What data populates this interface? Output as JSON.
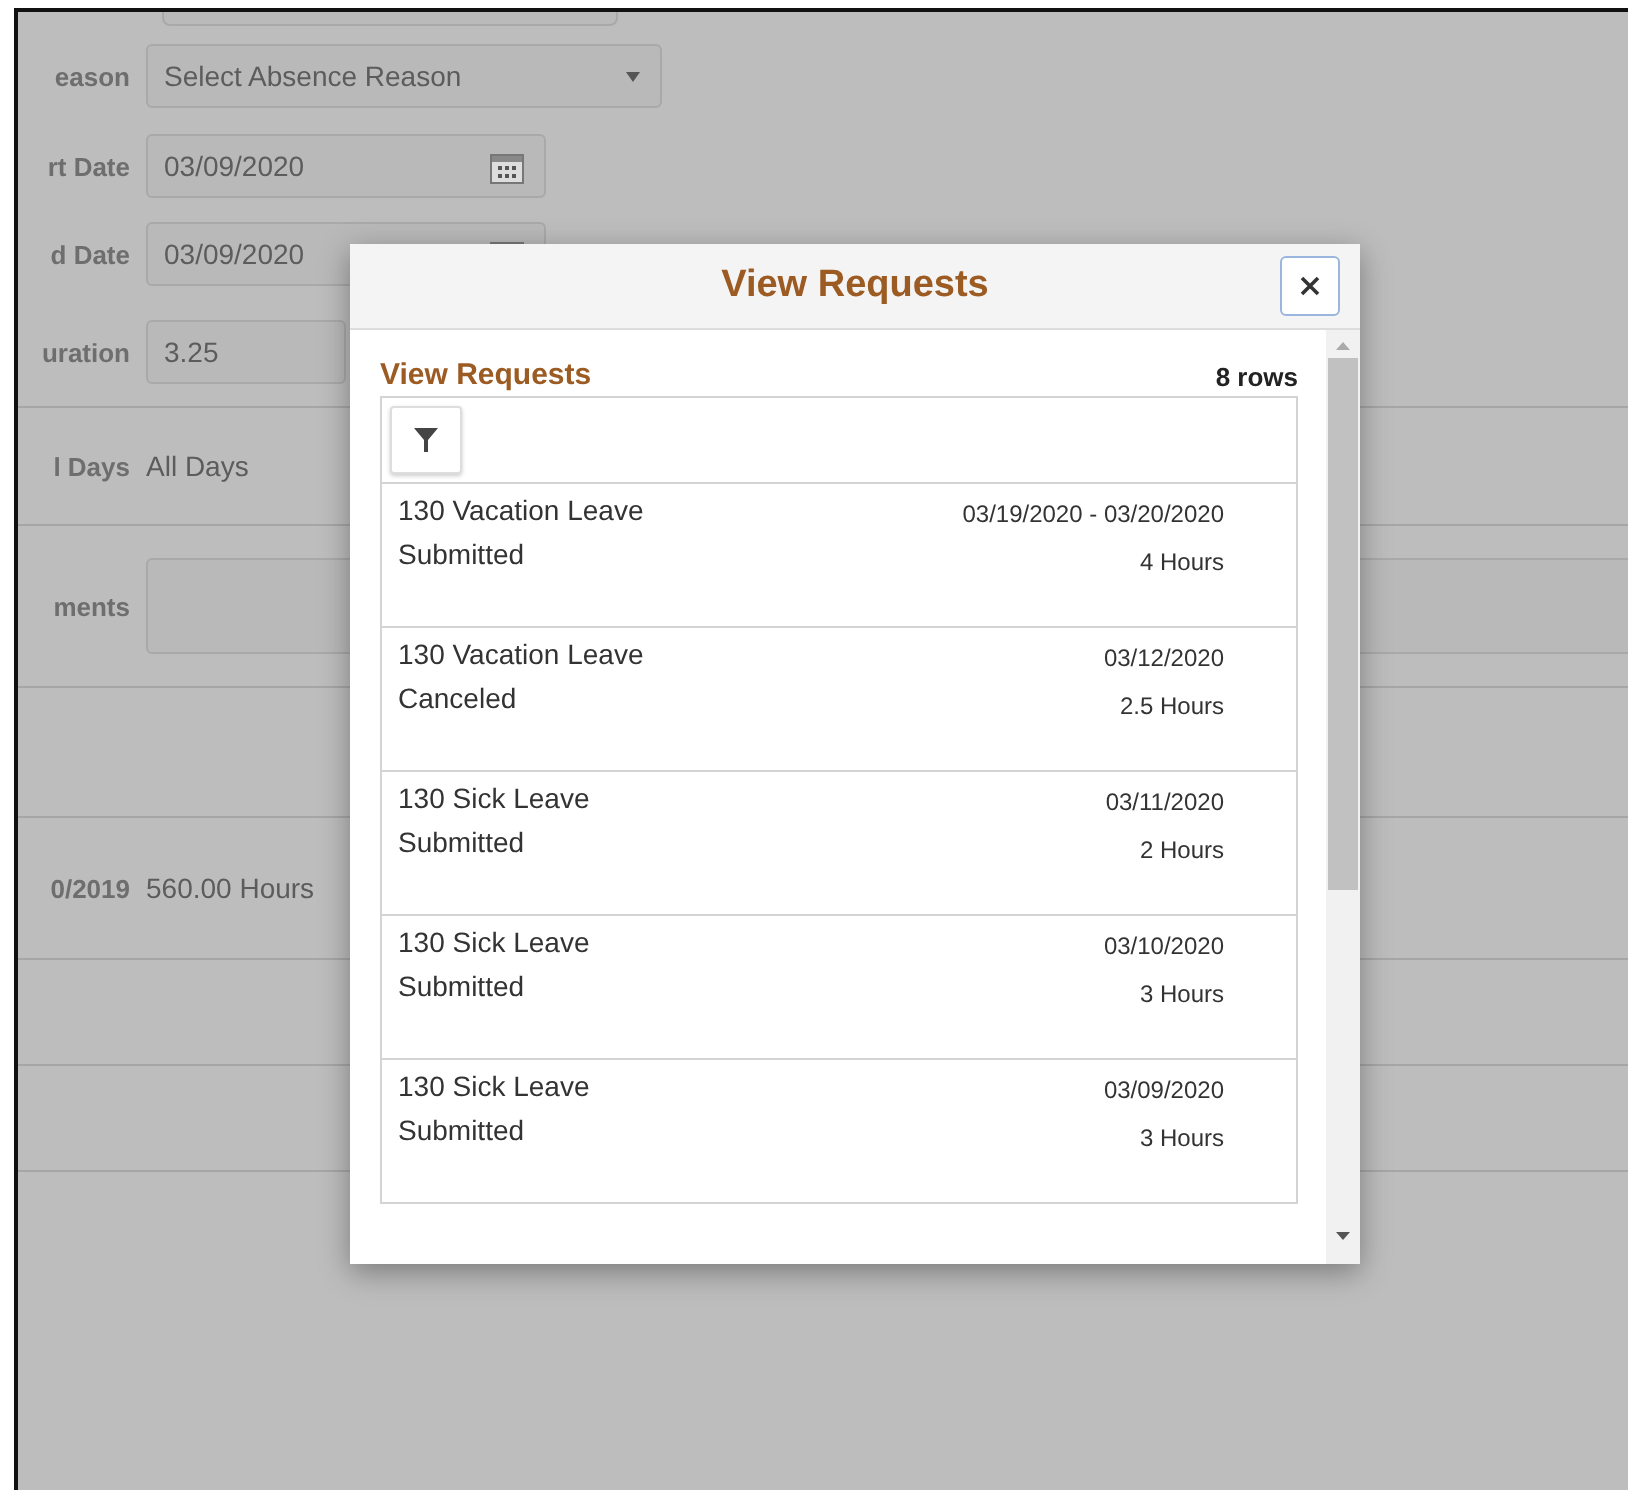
{
  "form": {
    "rows": [
      {
        "kind": "select",
        "label": "eason",
        "value": "Select Absence Reason"
      },
      {
        "kind": "date",
        "label": "rt Date",
        "value": "03/09/2020"
      },
      {
        "kind": "date",
        "label": "d Date",
        "value": "03/09/2020"
      },
      {
        "kind": "input",
        "label": "uration",
        "value": "3.25"
      },
      {
        "kind": "text",
        "label": "l Days",
        "value": "All Days"
      },
      {
        "kind": "textarea",
        "label": "ments",
        "value": ""
      },
      {
        "kind": "blank"
      },
      {
        "kind": "text",
        "label": "0/2019",
        "value": "560.00 Hours"
      },
      {
        "kind": "blank"
      },
      {
        "kind": "blank"
      }
    ]
  },
  "modal": {
    "title": "View Requests",
    "section_title": "View Requests",
    "row_count": "8 rows",
    "requests": [
      {
        "type": "130 Vacation Leave",
        "status": "Submitted",
        "dates": "03/19/2020 - 03/20/2020",
        "duration": "4 Hours"
      },
      {
        "type": "130 Vacation Leave",
        "status": "Canceled",
        "dates": "03/12/2020",
        "duration": "2.5 Hours"
      },
      {
        "type": "130 Sick Leave",
        "status": "Submitted",
        "dates": "03/11/2020",
        "duration": "2 Hours"
      },
      {
        "type": "130 Sick Leave",
        "status": "Submitted",
        "dates": "03/10/2020",
        "duration": "3 Hours"
      },
      {
        "type": "130 Sick Leave",
        "status": "Submitted",
        "dates": "03/09/2020",
        "duration": "3 Hours"
      }
    ]
  }
}
